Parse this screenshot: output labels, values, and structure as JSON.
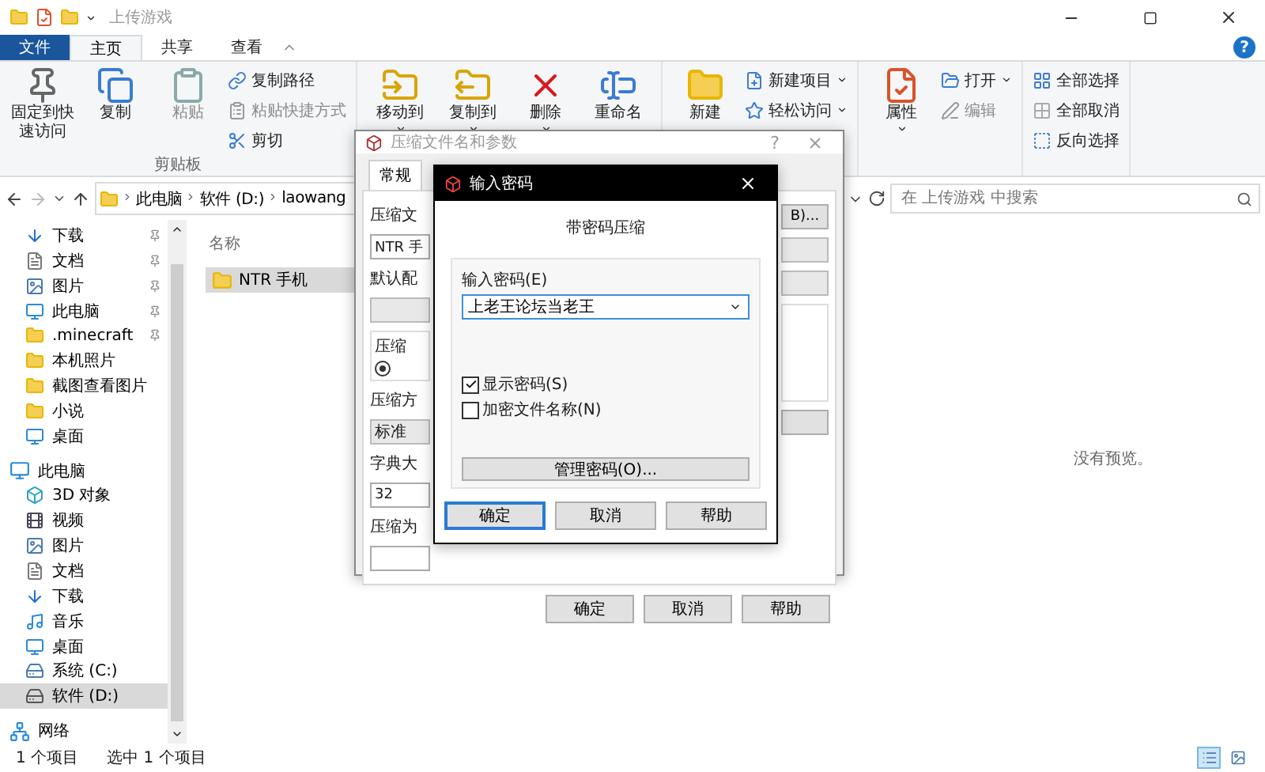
{
  "window": {
    "title": "上传游戏"
  },
  "ribbon_tabs": [
    {
      "label": "文件",
      "kind": "file",
      "selected": false
    },
    {
      "label": "主页",
      "kind": "tab",
      "selected": true
    },
    {
      "label": "共享",
      "kind": "tab",
      "selected": false
    },
    {
      "label": "查看",
      "kind": "tab",
      "selected": false
    }
  ],
  "help_button": "?",
  "ribbon_groups": [
    {
      "label": "剪贴板",
      "large": [
        {
          "kind": "pin",
          "label": "固定到快速访问",
          "disabled": false,
          "dropdown": false
        },
        {
          "kind": "copy",
          "label": "复制",
          "disabled": false,
          "dropdown": false
        },
        {
          "kind": "paste",
          "label": "粘贴",
          "disabled": true,
          "dropdown": false
        }
      ],
      "small": [
        {
          "kind": "path",
          "label": "复制路径",
          "disabled": false,
          "dropdown": false
        },
        {
          "kind": "shortcut",
          "label": "粘贴快捷方式",
          "disabled": true,
          "dropdown": false
        },
        {
          "kind": "cut",
          "label": "剪切",
          "disabled": false,
          "dropdown": false
        }
      ]
    },
    {
      "large": [
        {
          "kind": "move",
          "label": "移动到",
          "disabled": false,
          "dropdown": true
        },
        {
          "kind": "copyto",
          "label": "复制到",
          "disabled": false,
          "dropdown": true
        },
        {
          "kind": "delete",
          "label": "删除",
          "disabled": false,
          "dropdown": true
        },
        {
          "kind": "rename",
          "label": "重命名",
          "disabled": false,
          "dropdown": false
        }
      ]
    },
    {
      "large": [
        {
          "kind": "newfolder",
          "label": "新建",
          "disabled": false,
          "dropdown": false
        }
      ],
      "small": [
        {
          "kind": "newitem",
          "label": "新建项目",
          "disabled": false,
          "dropdown": true
        },
        {
          "kind": "easyaccess",
          "label": "轻松访问",
          "disabled": false,
          "dropdown": true
        }
      ]
    },
    {
      "large": [
        {
          "kind": "properties",
          "label": "属性",
          "disabled": false,
          "dropdown": true
        }
      ],
      "small": [
        {
          "kind": "open",
          "label": "打开",
          "disabled": false,
          "dropdown": true
        },
        {
          "kind": "edit",
          "label": "编辑",
          "disabled": true,
          "dropdown": false
        }
      ]
    },
    {
      "small": [
        {
          "kind": "selectall",
          "label": "全部选择",
          "disabled": false,
          "dropdown": false
        },
        {
          "kind": "selectnone",
          "label": "全部取消",
          "disabled": false,
          "dropdown": false
        },
        {
          "kind": "invert",
          "label": "反向选择",
          "disabled": false,
          "dropdown": false
        }
      ]
    }
  ],
  "address": {
    "crumbs": [
      "此电脑",
      "软件 (D:)",
      "laowang"
    ],
    "search_placeholder": "在 上传游戏 中搜索"
  },
  "nav": {
    "quick_access": [
      {
        "label": "下载",
        "kind": "download",
        "pinned": true,
        "selected": false
      },
      {
        "label": "文档",
        "kind": "document",
        "pinned": true,
        "selected": false
      },
      {
        "label": "图片",
        "kind": "picture",
        "pinned": true,
        "selected": false
      },
      {
        "label": "此电脑",
        "kind": "computer",
        "pinned": true,
        "selected": false
      },
      {
        "label": ".minecraft",
        "kind": "folder",
        "pinned": true,
        "selected": false
      },
      {
        "label": "本机照片",
        "kind": "folder",
        "pinned": false,
        "selected": false
      },
      {
        "label": "截图查看图片",
        "kind": "folder",
        "pinned": false,
        "selected": false
      },
      {
        "label": "小说",
        "kind": "folder",
        "pinned": false,
        "selected": false
      },
      {
        "label": "桌面",
        "kind": "desktop",
        "pinned": false,
        "selected": false
      }
    ],
    "tree": [
      {
        "label": "此电脑",
        "kind": "computer",
        "selected": false,
        "children": [
          {
            "label": "3D 对象",
            "kind": "cube",
            "selected": false
          },
          {
            "label": "视频",
            "kind": "video",
            "selected": false
          },
          {
            "label": "图片",
            "kind": "picture",
            "selected": false
          },
          {
            "label": "文档",
            "kind": "document",
            "selected": false
          },
          {
            "label": "下载",
            "kind": "download",
            "selected": false
          },
          {
            "label": "音乐",
            "kind": "music",
            "selected": false
          },
          {
            "label": "桌面",
            "kind": "desktop",
            "selected": false
          },
          {
            "label": "系统 (C:)",
            "kind": "system-drive",
            "selected": false
          },
          {
            "label": "软件 (D:)",
            "kind": "drive",
            "selected": true
          }
        ]
      },
      {
        "label": "网络",
        "kind": "network",
        "selected": false
      }
    ]
  },
  "file_list": {
    "columns": [
      "名称"
    ],
    "rows": [
      {
        "name": "NTR 手机",
        "selected": true
      }
    ]
  },
  "preview": {
    "message": "没有预览。"
  },
  "status_bar": {
    "item_count": "1 个项目",
    "selection": "选中 1 个项目"
  },
  "view_buttons": [
    {
      "kind": "details",
      "selected": true
    },
    {
      "kind": "large-icons",
      "selected": false
    }
  ],
  "archive_dialog": {
    "title": "压缩文件名和参数",
    "help": "?",
    "tabs": [
      {
        "label": "常规",
        "selected": true
      }
    ],
    "left": [
      {
        "kind": "label",
        "text": "压缩文"
      },
      {
        "kind": "field",
        "text": "NTR 手"
      },
      {
        "kind": "label",
        "text": "默认配"
      },
      {
        "kind": "combo"
      },
      {
        "kind": "group",
        "text": "压缩",
        "selected": true
      },
      {
        "kind": "label",
        "text": "压缩方"
      },
      {
        "kind": "combo",
        "text": "标准"
      },
      {
        "kind": "label",
        "text": "字典大"
      },
      {
        "kind": "field",
        "text": "32"
      },
      {
        "kind": "label",
        "text": "压缩为"
      },
      {
        "kind": "field"
      }
    ],
    "right": [
      {
        "kind": "button",
        "text": "B)..."
      },
      {
        "kind": "combo"
      },
      {
        "kind": "combo"
      },
      {
        "kind": "list"
      },
      {
        "kind": "button"
      }
    ],
    "buttons": [
      "确定",
      "取消",
      "帮助"
    ]
  },
  "password_dialog": {
    "title": "输入密码",
    "heading": "带密码压缩",
    "password_label": "输入密码(E)",
    "password_value": "上老王论坛当老王",
    "options": [
      {
        "label": "显示密码(S)",
        "checked": true
      },
      {
        "label": "加密文件名称(N)",
        "checked": false
      }
    ],
    "manage_button": "管理密码(O)...",
    "buttons": [
      {
        "label": "确定",
        "default": true
      },
      {
        "label": "取消",
        "default": false
      },
      {
        "label": "帮助",
        "default": false
      }
    ]
  }
}
